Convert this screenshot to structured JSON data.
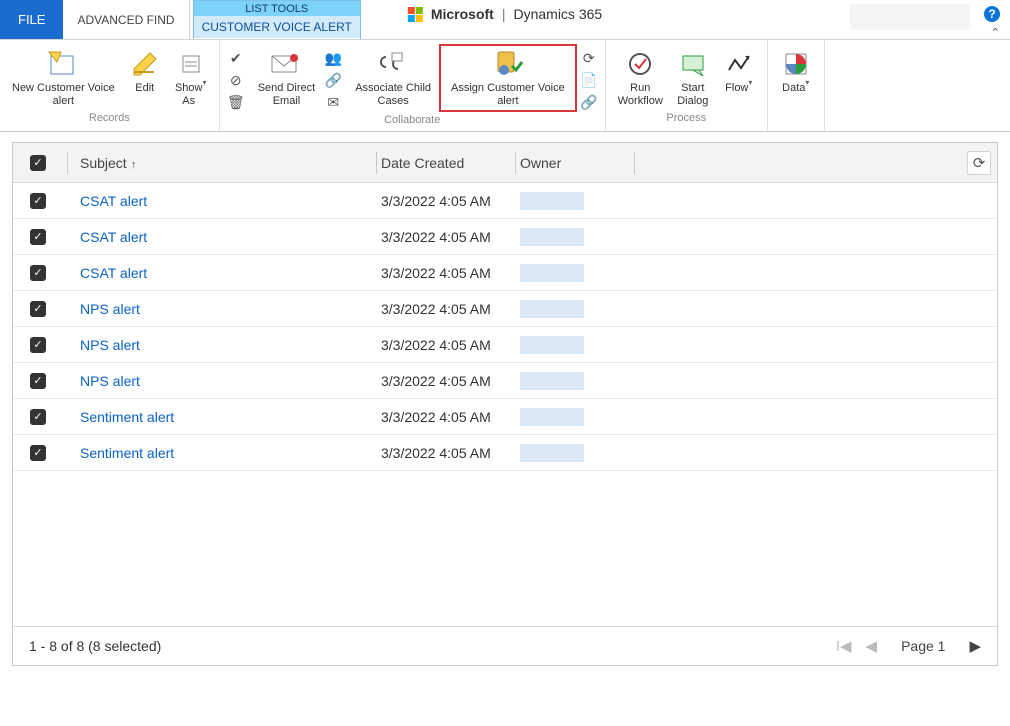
{
  "header": {
    "file_tab": "FILE",
    "adv_find_tab": "ADVANCED FIND",
    "context_group_header": "LIST TOOLS",
    "context_group_item": "CUSTOMER VOICE ALERT",
    "brand_ms": "Microsoft",
    "brand_product": "Dynamics 365"
  },
  "ribbon": {
    "records": {
      "label": "Records",
      "new_alert": "New Customer Voice\nalert",
      "edit": "Edit",
      "show_as": "Show\nAs"
    },
    "collaborate": {
      "label": "Collaborate",
      "send_email": "Send Direct\nEmail",
      "associate": "Associate Child\nCases",
      "assign": "Assign Customer Voice\nalert"
    },
    "process": {
      "label": "Process",
      "workflow": "Run\nWorkflow",
      "dialog": "Start\nDialog",
      "flow": "Flow"
    },
    "data": {
      "label": "",
      "data": "Data"
    }
  },
  "grid": {
    "columns": {
      "subject": "Subject",
      "date": "Date Created",
      "owner": "Owner"
    },
    "rows": [
      {
        "subject": "CSAT alert",
        "date": "3/3/2022 4:05 AM"
      },
      {
        "subject": "CSAT alert",
        "date": "3/3/2022 4:05 AM"
      },
      {
        "subject": "CSAT alert",
        "date": "3/3/2022 4:05 AM"
      },
      {
        "subject": "NPS alert",
        "date": "3/3/2022 4:05 AM"
      },
      {
        "subject": "NPS alert",
        "date": "3/3/2022 4:05 AM"
      },
      {
        "subject": "NPS alert",
        "date": "3/3/2022 4:05 AM"
      },
      {
        "subject": "Sentiment alert",
        "date": "3/3/2022 4:05 AM"
      },
      {
        "subject": "Sentiment alert",
        "date": "3/3/2022 4:05 AM"
      }
    ],
    "footer": {
      "status": "1 - 8 of 8 (8 selected)",
      "page_label": "Page 1"
    }
  }
}
